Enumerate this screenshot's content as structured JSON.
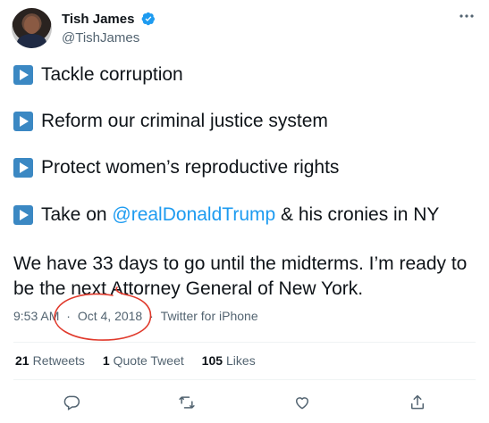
{
  "author": {
    "display_name": "Tish James",
    "handle": "@TishJames"
  },
  "tweet": {
    "bullets": [
      {
        "text": "Tackle corruption"
      },
      {
        "text": "Reform our criminal justice system"
      },
      {
        "text": "Protect women’s reproductive rights"
      },
      {
        "prefix": "Take on ",
        "mention": "@realDonaldTrump",
        "suffix": " & his cronies in NY"
      }
    ],
    "closing": "We have 33 days to go until the midterms. I’m ready to be the next Attorney General of New York."
  },
  "meta": {
    "time": "9:53 AM",
    "separator": "·",
    "date": "Oct 4, 2018",
    "source": "Twitter for iPhone"
  },
  "stats": {
    "retweets_count": "21",
    "retweets_label": "Retweets",
    "quotes_count": "1",
    "quotes_label": "Quote Tweet",
    "likes_count": "105",
    "likes_label": "Likes"
  },
  "colors": {
    "accent": "#1d9bf0",
    "bullet": "#3b88c3",
    "annotation": "#e0392b",
    "secondary_text": "#536471"
  },
  "icons": [
    "verified-icon",
    "more-icon",
    "play-button-icon",
    "reply-icon",
    "retweet-icon",
    "like-icon",
    "share-icon"
  ]
}
